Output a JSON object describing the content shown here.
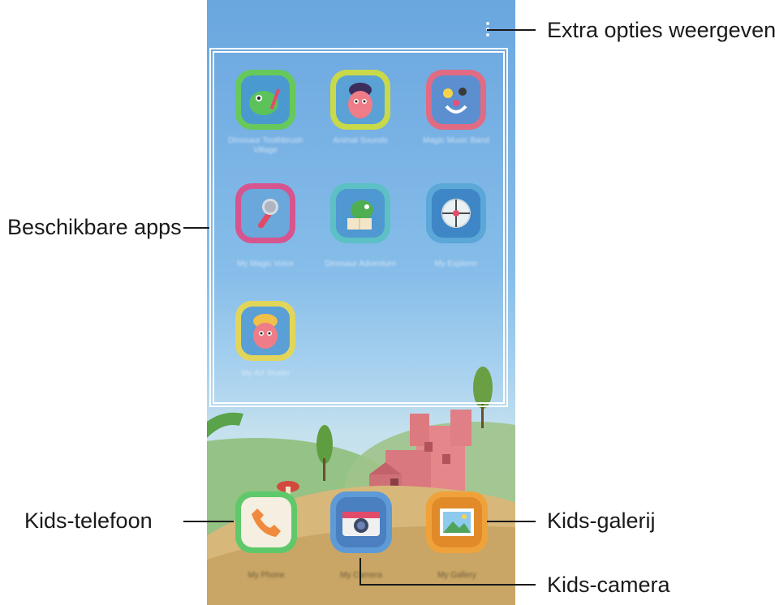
{
  "callouts": {
    "more_options": "Extra opties weergeven.",
    "available_apps": "Beschikbare apps",
    "kids_phone": "Kids-telefoon",
    "kids_gallery": "Kids-galerij",
    "kids_camera": "Kids-camera"
  },
  "apps": [
    {
      "icon": "dinosaur-toothbrush-icon",
      "border": "#66c95a",
      "label": "Dinosaur Toothbrush Village"
    },
    {
      "icon": "character-pink-icon",
      "border": "#c8d94a",
      "label": "Animal Sounds"
    },
    {
      "icon": "music-band-icon",
      "border": "#e06b83",
      "label": "Magic Music Band"
    },
    {
      "icon": "microphone-icon",
      "border": "#d6558f",
      "label": "My Magic Voice"
    },
    {
      "icon": "dinosaur-book-icon",
      "border": "#5cc0c4",
      "label": "Dinosaur Adventure"
    },
    {
      "icon": "compass-icon",
      "border": "#5aa7d8",
      "label": "My Explorer"
    },
    {
      "icon": "character-blonde-icon",
      "border": "#e2d65a",
      "label": "My Art Studio"
    }
  ],
  "dock": [
    {
      "icon": "phone-handset-icon",
      "border": "#5fc86a",
      "label": "My Phone"
    },
    {
      "icon": "camera-icon",
      "border": "#5e9ad6",
      "label": "My Camera"
    },
    {
      "icon": "gallery-picture-icon",
      "border": "#f0a23a",
      "label": "My Gallery"
    }
  ]
}
